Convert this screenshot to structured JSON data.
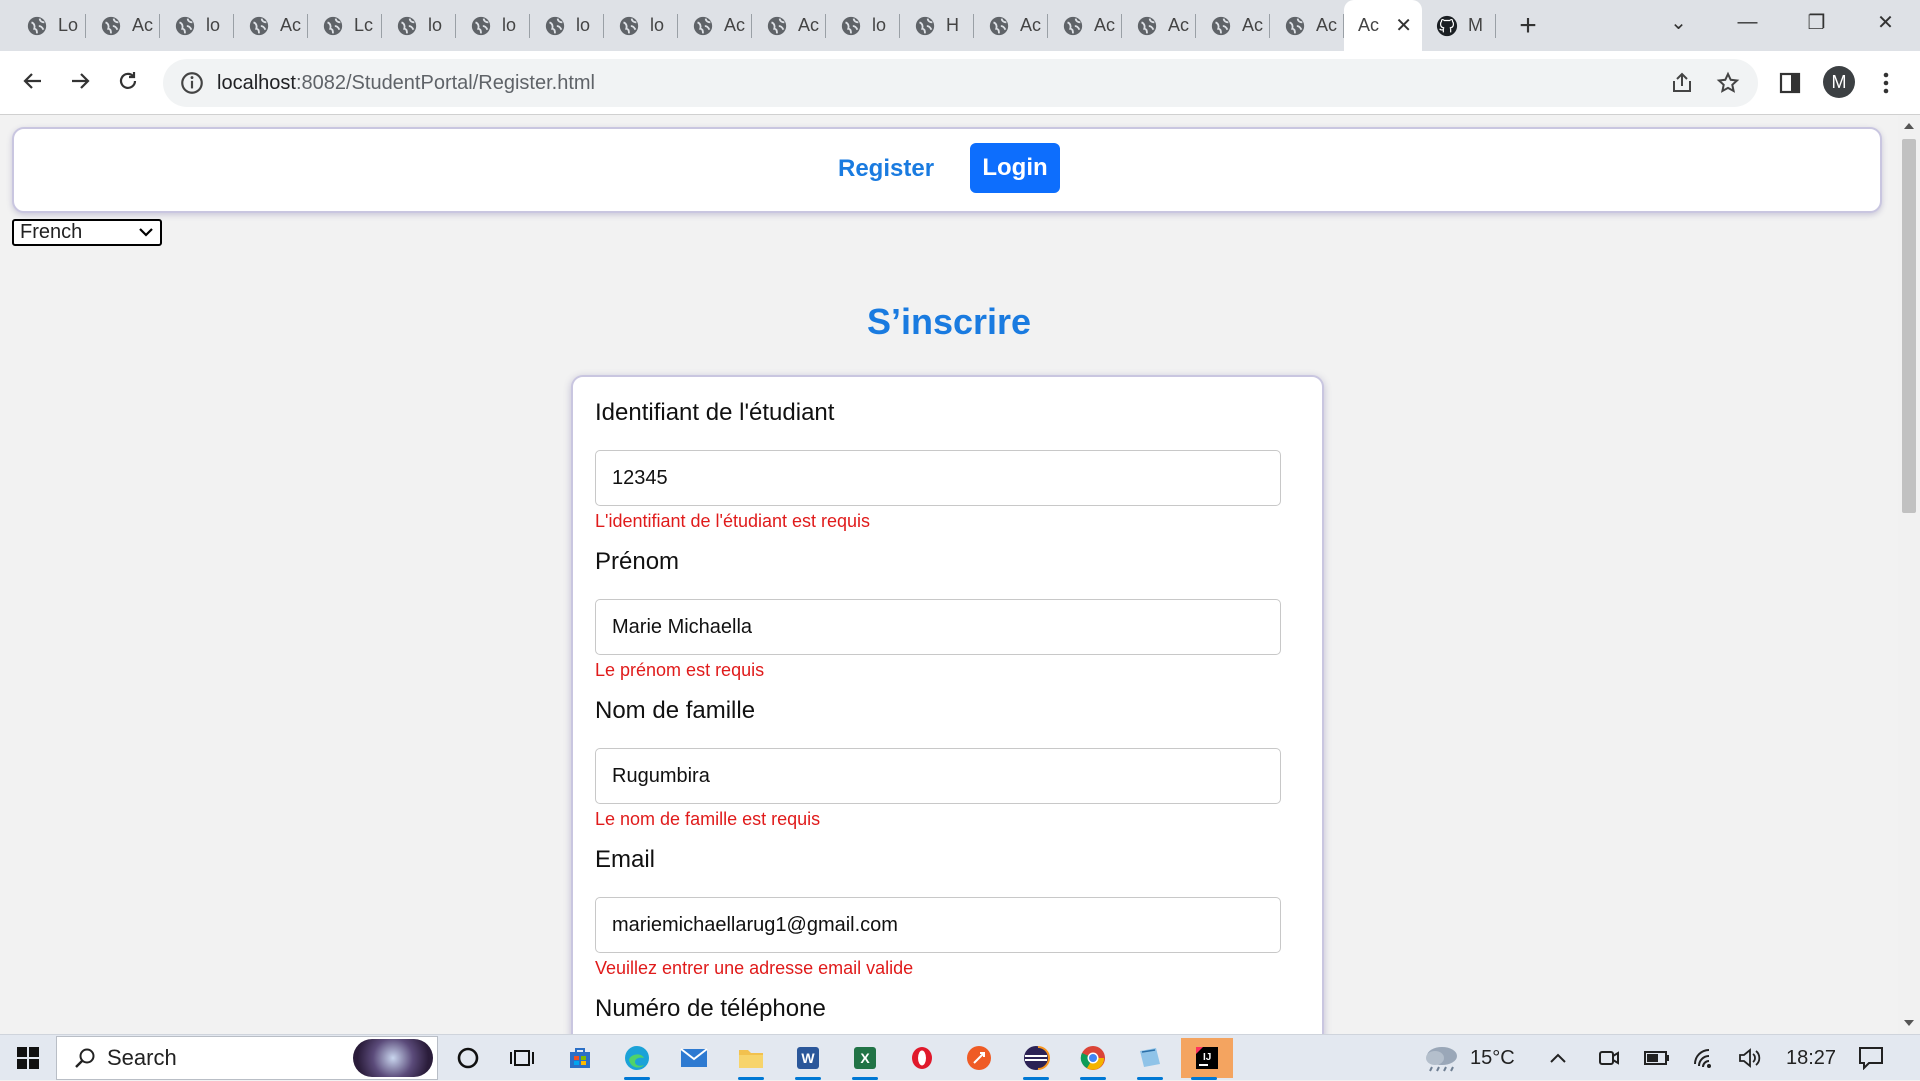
{
  "browser": {
    "tabs": [
      {
        "label": "Lo",
        "icon": "globe-icon"
      },
      {
        "label": "Ac",
        "icon": "globe-icon"
      },
      {
        "label": "lo",
        "icon": "globe-icon"
      },
      {
        "label": "Ac",
        "icon": "globe-icon"
      },
      {
        "label": "Lc",
        "icon": "globe-icon"
      },
      {
        "label": "lo",
        "icon": "globe-icon"
      },
      {
        "label": "lo",
        "icon": "globe-icon"
      },
      {
        "label": "lo",
        "icon": "globe-icon"
      },
      {
        "label": "lo",
        "icon": "globe-icon"
      },
      {
        "label": "Ac",
        "icon": "globe-icon"
      },
      {
        "label": "Ac",
        "icon": "globe-icon"
      },
      {
        "label": "lo",
        "icon": "globe-icon"
      },
      {
        "label": "H",
        "icon": "globe-icon"
      },
      {
        "label": "Ac",
        "icon": "globe-icon"
      },
      {
        "label": "Ac",
        "icon": "globe-icon"
      },
      {
        "label": "Ac",
        "icon": "globe-icon"
      },
      {
        "label": "Ac",
        "icon": "globe-icon"
      },
      {
        "label": "Ac",
        "icon": "globe-icon"
      },
      {
        "label": "Ac",
        "icon": "none",
        "active": true
      },
      {
        "label": "M",
        "icon": "github-icon"
      }
    ],
    "url_host": "localhost",
    "url_rest": ":8082/StudentPortal/Register.html",
    "profile_initial": "M"
  },
  "nav": {
    "register_label": "Register",
    "login_label": "Login",
    "accent_color": "#1a7be0",
    "login_bg": "#0d6efd"
  },
  "language": {
    "selected": "French"
  },
  "page": {
    "title": "S’inscrire"
  },
  "form": {
    "fields": [
      {
        "label": "Identifiant de l'étudiant",
        "value": "12345",
        "error": "L'identifiant de l'étudiant est requis"
      },
      {
        "label": "Prénom",
        "value": "Marie Michaella",
        "error": "Le prénom est requis"
      },
      {
        "label": "Nom de famille",
        "value": "Rugumbira",
        "error": "Le nom de famille est requis"
      },
      {
        "label": "Email",
        "value": "mariemichaellarug1@gmail.com",
        "error": "Veuillez entrer une adresse email valide"
      },
      {
        "label": "Numéro de téléphone",
        "value": "",
        "error": ""
      }
    ],
    "error_color": "#e01b1b"
  },
  "taskbar": {
    "search_label": "Search",
    "weather": "15°C",
    "time": "18:27"
  }
}
